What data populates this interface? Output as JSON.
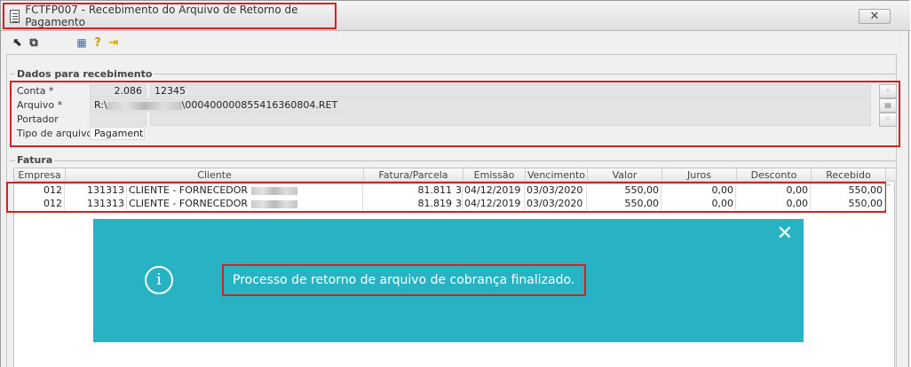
{
  "window": {
    "title": "FCTFP007 - Recebimento do Arquivo de Retorno de Pagamento",
    "close_label": "✕"
  },
  "toolbar": {
    "buttons": [
      {
        "name": "import-icon",
        "glyph": "⬉"
      },
      {
        "name": "layers-icon",
        "glyph": "⧉"
      },
      {
        "name": "grid-icon",
        "glyph": "▦"
      },
      {
        "name": "help-icon",
        "glyph": "?"
      },
      {
        "name": "exit-icon",
        "glyph": "⇥"
      }
    ]
  },
  "form": {
    "legend": "Dados para recebimento",
    "conta": {
      "label": "Conta *",
      "code": "2.086",
      "name": "12345"
    },
    "arquivo": {
      "label": "Arquivo *",
      "prefix": "R:\\",
      "suffix": "\\000400000855416360804.RET"
    },
    "portador": {
      "label": "Portador",
      "code": "",
      "name": ""
    },
    "tipo": {
      "label": "Tipo de arquivo",
      "value": "Pagamento"
    }
  },
  "fatura": {
    "legend": "Fatura",
    "columns": [
      "Empresa",
      "Cliente",
      "Fatura/Parcela",
      "Emissão",
      "Vencimento",
      "Valor",
      "Juros",
      "Desconto",
      "Recebido"
    ],
    "rows": [
      {
        "empresa": "012",
        "cliente_cod": "131313",
        "cliente_nome": "CLIENTE - FORNECEDOR",
        "fatura": "81.811",
        "parcela": "3",
        "emissao": "04/12/2019",
        "vencimento": "03/03/2020",
        "valor": "550,00",
        "juros": "0,00",
        "desconto": "0,00",
        "recebido": "550,00"
      },
      {
        "empresa": "012",
        "cliente_cod": "131313",
        "cliente_nome": "CLIENTE - FORNECEDOR",
        "fatura": "81.819",
        "parcela": "3",
        "emissao": "04/12/2019",
        "vencimento": "03/03/2020",
        "valor": "550,00",
        "juros": "0,00",
        "desconto": "0,00",
        "recebido": "550,00"
      }
    ]
  },
  "notification": {
    "message": "Processo de retorno de arquivo de cobrança finalizado.",
    "close_glyph": "✕",
    "info_glyph": "i",
    "color": "#27b3c3"
  }
}
